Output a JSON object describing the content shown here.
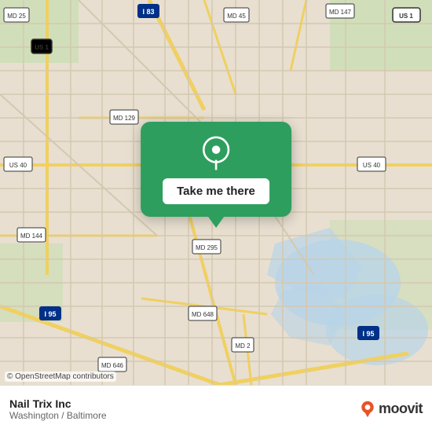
{
  "map": {
    "alt": "Map of Washington / Baltimore area",
    "background_color": "#e8dfd0"
  },
  "popup": {
    "button_label": "Take me there",
    "pin_color": "#ffffff",
    "card_color": "#2e9e5e"
  },
  "attribution": {
    "text": "© OpenStreetMap contributors"
  },
  "info_bar": {
    "location_name": "Nail Trix Inc",
    "location_city": "Washington / Baltimore",
    "logo_text": "moovit"
  },
  "icons": {
    "pin": "📍",
    "moovit_pin": "🔴"
  }
}
